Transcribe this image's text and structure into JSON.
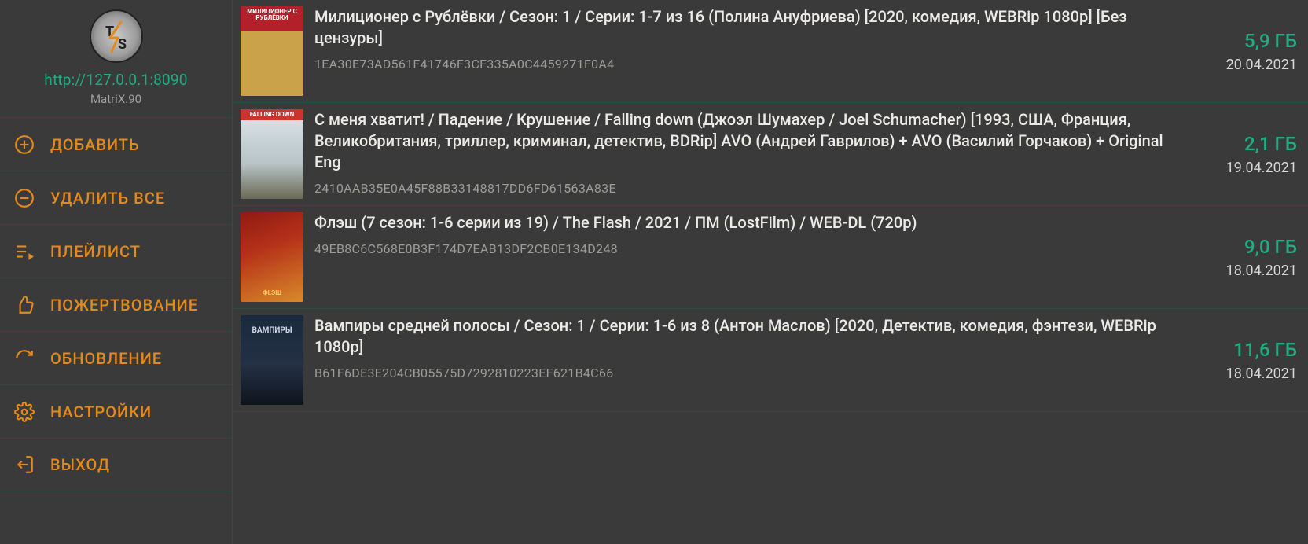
{
  "header": {
    "server_url": "http://127.0.0.1:8090",
    "version": "MatriX.90"
  },
  "sidebar": {
    "items": [
      {
        "icon": "plus-circle-icon",
        "label": "ДОБАВИТЬ"
      },
      {
        "icon": "minus-circle-icon",
        "label": "УДАЛИТЬ ВСЕ"
      },
      {
        "icon": "playlist-icon",
        "label": "ПЛЕЙЛИСТ"
      },
      {
        "icon": "thumbs-up-icon",
        "label": "ПОЖЕРТВОВАНИЕ"
      },
      {
        "icon": "refresh-icon",
        "label": "ОБНОВЛЕНИЕ"
      },
      {
        "icon": "gear-icon",
        "label": "НАСТРОЙКИ"
      },
      {
        "icon": "exit-icon",
        "label": "ВЫХОД"
      }
    ]
  },
  "torrents": [
    {
      "poster_tag": "МИЛИЦИОНЕР С РУБЛЁВКИ",
      "poster_bg": "linear-gradient(180deg,#b2212a 0%,#b2212a 28%,#caa24a 28%,#caa24a 100%)",
      "poster_tag_bg": "#b2212a",
      "poster_tag_color": "#fff",
      "title": "Милиционер с Рублёвки / Сезон: 1 / Серии: 1-7 из 16 (Полина Ануфриева) [2020, комедия, WEBRip 1080p] [Без цензуры]",
      "hash": "1EA30E73AD561F41746F3CF335A0C4459271F0A4",
      "size": "5,9 ГБ",
      "date": "20.04.2021"
    },
    {
      "poster_tag": "FALLING DOWN",
      "poster_bg": "linear-gradient(180deg,#dfe7ea 0%,#b8c4c8 60%,#6a6a55 100%)",
      "poster_tag_bg": "#c9342c",
      "poster_tag_color": "#fff",
      "title": "С меня хватит! / Падение / Крушение / Falling down (Джоэл Шумахер / Joel Schumacher) [1993, США, Франция, Великобритания, триллер, криминал, детектив, BDRip] AVO (Андрей Гаврилов) + AVO (Василий Горчаков) + Original Eng",
      "hash": "2410AAB35E0A45F88B33148817DD6FD61563A83E",
      "size": "2,1 ГБ",
      "date": "19.04.2021"
    },
    {
      "poster_tag": "ФLЭШ",
      "poster_bg": "linear-gradient(160deg,#8f1a12 0%,#b53219 40%,#d98a2a 100%)",
      "poster_tag_bg": "transparent",
      "poster_tag_color": "#f0d060",
      "title": "Флэш (7 сезон: 1-6 серии из 19) / The Flash / 2021 / ПМ (LostFilm) / WEB-DL (720p)",
      "hash": "49EB8C6C568E0B3F174D7EAB13DF2CB0E134D248",
      "size": "9,0 ГБ",
      "date": "18.04.2021"
    },
    {
      "poster_tag": "ВАМПИРЫ",
      "poster_bg": "linear-gradient(180deg,#1a2a3d 0%,#243044 55%,#0e141c 100%)",
      "poster_tag_bg": "transparent",
      "poster_tag_color": "#cfd8e2",
      "title": "Вампиры средней полосы / Сезон: 1 / Серии: 1-6 из 8 (Антон Маслов) [2020, Детектив, комедия, фэнтези, WEBRip 1080p]",
      "hash": "B61F6DE3E204CB05575D7292810223EF621B4C66",
      "size": "11,6 ГБ",
      "date": "18.04.2021"
    }
  ]
}
